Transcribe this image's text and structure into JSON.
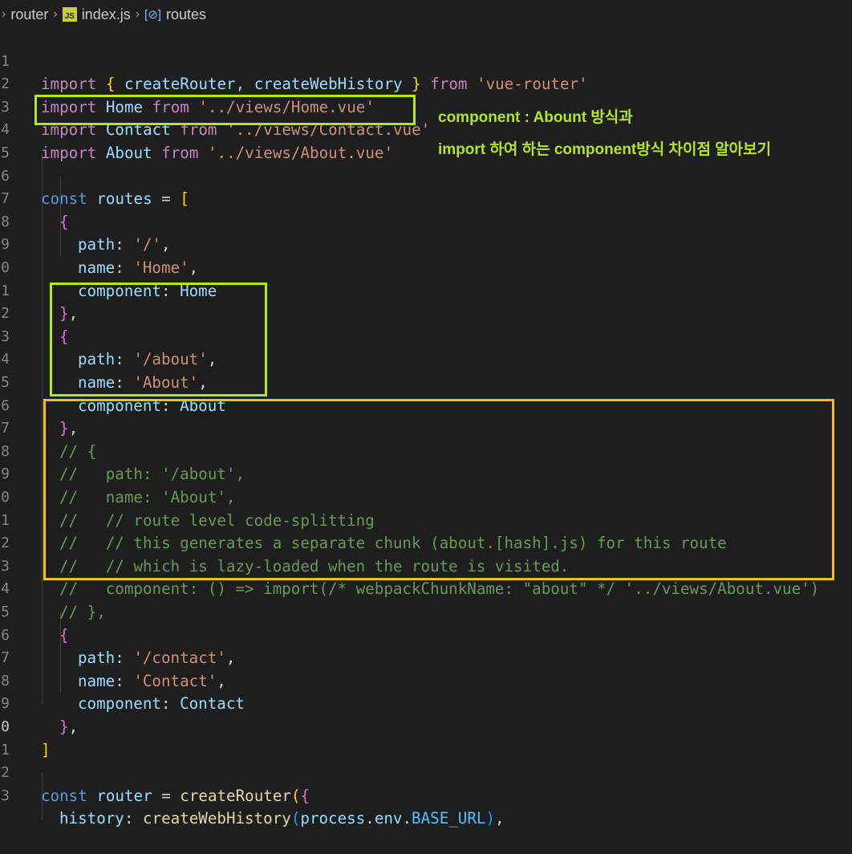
{
  "breadcrumb": {
    "folder": "router",
    "file_badge": "JS",
    "file": "index.js",
    "symbol": "routes"
  },
  "annotations": {
    "note1": "component : Abount 방식과",
    "note2": "import 하여 하는 component방식 차이점 알아보기",
    "highlight_green": "#b5e61d",
    "highlight_yellow": "#f5c016"
  },
  "line_numbers": [
    "1",
    "2",
    "3",
    "4",
    "5",
    "6",
    "7",
    "8",
    "9",
    "0",
    "1",
    "2",
    "3",
    "4",
    "5",
    "6",
    "7",
    "8",
    "9",
    "0",
    "1",
    "2",
    "3",
    "4",
    "5",
    "6",
    "7",
    "8",
    "9",
    "0",
    "1",
    "2",
    "3"
  ],
  "code": {
    "l1": [
      "import",
      " ",
      "{",
      " createRouter, createWebHistory ",
      "}",
      " ",
      "from",
      " ",
      "'vue-router'"
    ],
    "l2": [
      "import",
      " Home ",
      "from",
      " ",
      "'../views/Home.vue'"
    ],
    "l3": [
      "import",
      " Contact ",
      "from",
      " ",
      "'../views/Contact.vue'"
    ],
    "l4": [
      "import",
      " About ",
      "from",
      " ",
      "'../views/About.vue'"
    ],
    "l6": [
      "const",
      " ",
      "routes",
      " = ",
      "["
    ],
    "l7": [
      "{"
    ],
    "l8": [
      "path",
      ": ",
      "'/'",
      ","
    ],
    "l9": [
      "name",
      ": ",
      "'Home'",
      ","
    ],
    "l10": [
      "component",
      ": ",
      "Home"
    ],
    "l11": [
      "}",
      ","
    ],
    "l12": [
      "{"
    ],
    "l13": [
      "path",
      ": ",
      "'/about'",
      ","
    ],
    "l14": [
      "name",
      ": ",
      "'About'",
      ","
    ],
    "l15": [
      "component",
      ": ",
      "About"
    ],
    "l16": [
      "}",
      ","
    ],
    "l17": "// {",
    "l18": "//   path: '/about',",
    "l19": "//   name: 'About',",
    "l20": "//   // route level code-splitting",
    "l21": "//   // this generates a separate chunk (about.[hash].js) for this route",
    "l22": "//   // which is lazy-loaded when the route is visited.",
    "l23": "//   component: () => import(/* webpackChunkName: \"about\" */ '../views/About.vue')",
    "l24": "// },",
    "l25": [
      "{"
    ],
    "l26": [
      "path",
      ": ",
      "'/contact'",
      ","
    ],
    "l27": [
      "name",
      ": ",
      "'Contact'",
      ","
    ],
    "l28": [
      "component",
      ": ",
      "Contact"
    ],
    "l29": [
      "}",
      ","
    ],
    "l30": [
      "]"
    ],
    "l32": [
      "const",
      " ",
      "router",
      " = ",
      "createRouter",
      "(",
      "{"
    ],
    "l33": [
      "history",
      ": ",
      "createWebHistory",
      "(",
      "process",
      ".",
      "env",
      ".",
      "BASE_URL",
      ")",
      ","
    ]
  }
}
